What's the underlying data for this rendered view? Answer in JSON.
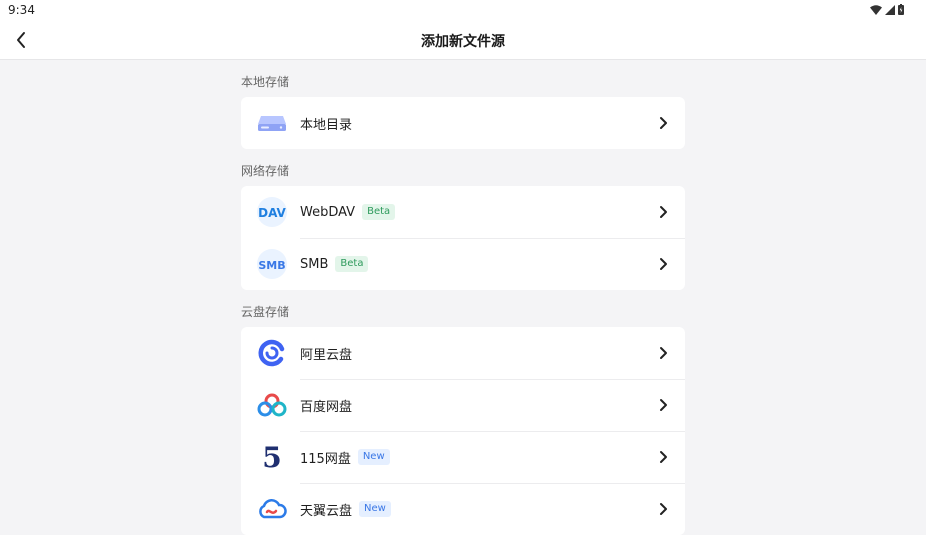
{
  "status": {
    "time": "9:34"
  },
  "appbar": {
    "title": "添加新文件源"
  },
  "sections": [
    {
      "label": "本地存储",
      "items": [
        {
          "label": "本地目录",
          "icon": "local-drive-icon"
        }
      ]
    },
    {
      "label": "网络存储",
      "items": [
        {
          "label": "WebDAV",
          "icon": "webdav-icon",
          "badge": "Beta"
        },
        {
          "label": "SMB",
          "icon": "smb-icon",
          "badge": "Beta"
        }
      ]
    },
    {
      "label": "云盘存储",
      "items": [
        {
          "label": "阿里云盘",
          "icon": "aliyun-drive-icon"
        },
        {
          "label": "百度网盘",
          "icon": "baidu-netdisk-icon"
        },
        {
          "label": "115网盘",
          "icon": "115-netdisk-icon",
          "badge": "New"
        },
        {
          "label": "天翼云盘",
          "icon": "tianyi-cloud-icon",
          "badge": "New"
        }
      ]
    }
  ],
  "icon_text": {
    "webdav": "DAV",
    "smb": "SMB",
    "n115": "5"
  },
  "colors": {
    "beta_bg": "#e3f5ea",
    "beta_text": "#2e9a5c",
    "new_bg": "#e5efff",
    "new_text": "#3a77e6"
  }
}
